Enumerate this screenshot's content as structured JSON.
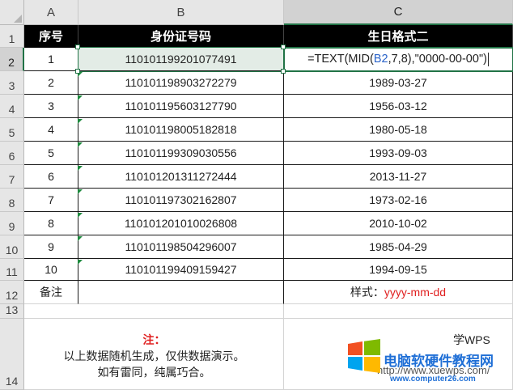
{
  "columns": [
    "A",
    "B",
    "C"
  ],
  "rows": [
    "1",
    "2",
    "3",
    "4",
    "5",
    "6",
    "7",
    "8",
    "9",
    "10",
    "11",
    "12",
    "13",
    "14"
  ],
  "header": {
    "seq": "序号",
    "id": "身份证号码",
    "birthday": "生日格式二"
  },
  "data_rows": [
    {
      "seq": "1",
      "id": "110101199201077491",
      "birthday": ""
    },
    {
      "seq": "2",
      "id": "110101198903272279",
      "birthday": "1989-03-27"
    },
    {
      "seq": "3",
      "id": "110101195603127790",
      "birthday": "1956-03-12"
    },
    {
      "seq": "4",
      "id": "110101198005182818",
      "birthday": "1980-05-18"
    },
    {
      "seq": "5",
      "id": "110101199309030556",
      "birthday": "1993-09-03"
    },
    {
      "seq": "6",
      "id": "110101201311272444",
      "birthday": "2013-11-27"
    },
    {
      "seq": "7",
      "id": "110101197302162807",
      "birthday": "1973-02-16"
    },
    {
      "seq": "8",
      "id": "110101201010026808",
      "birthday": "2010-10-02"
    },
    {
      "seq": "9",
      "id": "110101198504296007",
      "birthday": "1985-04-29"
    },
    {
      "seq": "10",
      "id": "110101199409159427",
      "birthday": "1994-09-15"
    }
  ],
  "formula": {
    "prefix": "=TEXT(MID(",
    "ref": "B2",
    "suffix": ",7,8),\"0000-00-00\")"
  },
  "remark": {
    "label": "备注",
    "style_label": "样式：",
    "style_value": "yyyy-mm-dd"
  },
  "note": {
    "title": "注：",
    "line1": "以上数据随机生成，仅供数据演示。",
    "line2": "如有雷同，纯属巧合。"
  },
  "watermark": {
    "brand": "学WPS",
    "site_name": "电脑软硬件教程网",
    "url_fragment": "http://www.xuewps.com/",
    "site_url": "www.computer26.com"
  },
  "colors": {
    "header_bg": "#000000",
    "selection": "#217346",
    "accent_red": "#e02020",
    "ref_blue": "#2a63c9"
  }
}
